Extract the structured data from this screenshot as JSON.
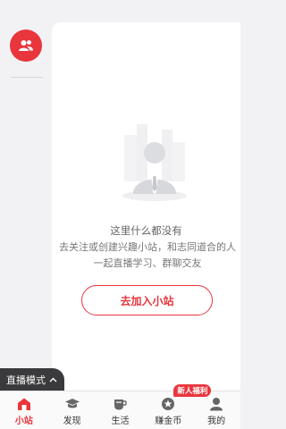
{
  "rail": {
    "group_icon": "group-users-icon"
  },
  "empty": {
    "title": "这里什么都没有",
    "desc": "去关注或创建兴趣小站，和志同道合的人一起直播学习、群聊交友"
  },
  "join_button": "去加入小站",
  "live_mode": {
    "label": "直播模式",
    "icon": "chevron-up-icon"
  },
  "tabs": [
    {
      "label": "小站",
      "icon": "home-station-icon",
      "active": true
    },
    {
      "label": "发现",
      "icon": "graduation-cap-icon"
    },
    {
      "label": "生活",
      "icon": "cup-icon"
    },
    {
      "label": "赚金币",
      "icon": "coin-star-icon",
      "badge": "新人福利"
    },
    {
      "label": "我的",
      "icon": "user-icon"
    }
  ],
  "colors": {
    "accent": "#e9353c",
    "background": "#f2f2f4"
  }
}
